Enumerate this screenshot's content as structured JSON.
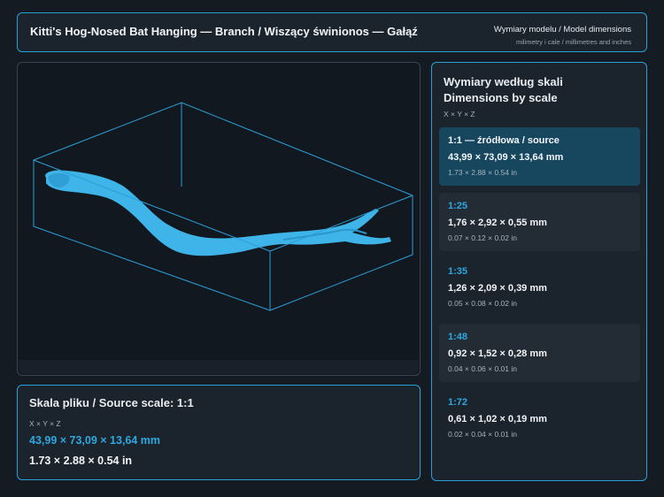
{
  "header": {
    "title": "Kitti's Hog-Nosed Bat Hanging — Branch / Wiszący świnionos — Gałąź",
    "dims_title": "Wymiary modelu / Model dimensions",
    "dims_subtitle": "milimetry i cale / millimetres and inches"
  },
  "source_panel": {
    "title": "Skala pliku / Source scale: 1:1",
    "axes": "X × Y × Z",
    "mm": "43,99 × 73,09 × 13,64 mm",
    "inches": "1.73 × 2.88 × 0.54 in"
  },
  "scales_panel": {
    "title_line1": "Wymiary według skali",
    "title_line2": "Dimensions by scale",
    "axes": "X × Y × Z",
    "items": [
      {
        "label": "1:1  —  źródłowa / source",
        "mm": "43,99 × 73,09 × 13,64 mm",
        "inches": "1.73 × 2.88 × 0.54 in"
      },
      {
        "label": "1:25",
        "mm": "1,76 × 2,92 × 0,55 mm",
        "inches": "0.07 × 0.12 × 0.02 in"
      },
      {
        "label": "1:35",
        "mm": "1,26 × 2,09 × 0,39 mm",
        "inches": "0.05 × 0.08 × 0.02 in"
      },
      {
        "label": "1:48",
        "mm": "0,92 × 1,52 × 0,28 mm",
        "inches": "0.04 × 0.06 × 0.01 in"
      },
      {
        "label": "1:72",
        "mm": "0,61 × 1,02 × 0,19 mm",
        "inches": "0.02 × 0.04 × 0.01 in"
      }
    ]
  },
  "colors": {
    "accent": "#2ea8e0",
    "model": "#3fb4e8",
    "bounding_box": "#2a9fd6",
    "background": "#151b22",
    "panel": "#1b232c",
    "highlight": "#17475f"
  },
  "icons": []
}
